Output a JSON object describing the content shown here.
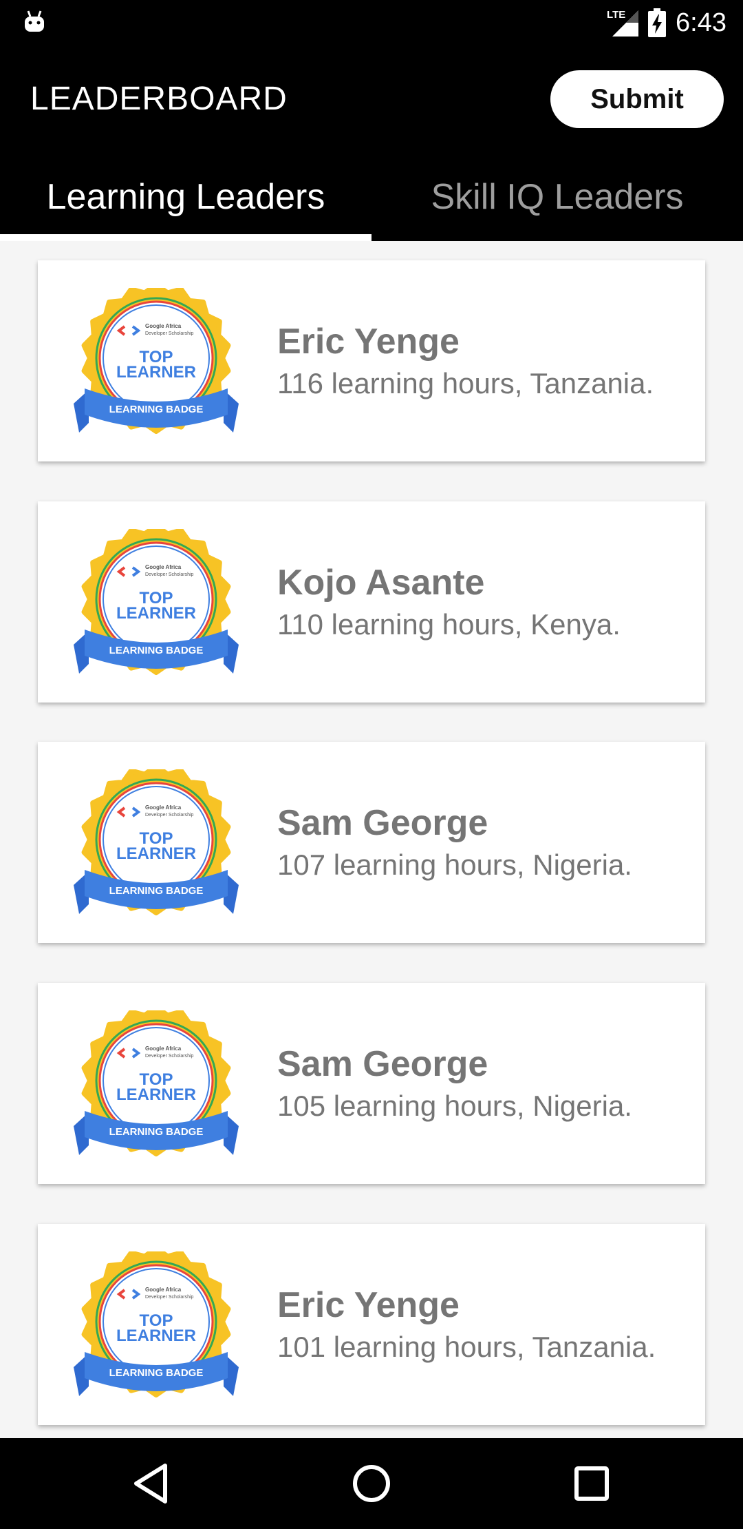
{
  "status_bar": {
    "network_label": "LTE",
    "time": "6:43"
  },
  "app_bar": {
    "title": "LEADERBOARD",
    "submit_label": "Submit"
  },
  "tabs": [
    {
      "label": "Learning Leaders",
      "selected": true
    },
    {
      "label": "Skill IQ Leaders",
      "selected": false
    }
  ],
  "badge": {
    "org_line1": "Google Africa",
    "org_line2": "Developer Scholarship",
    "line1": "TOP",
    "line2": "LEARNER",
    "ribbon": "LEARNING BADGE"
  },
  "leaders": [
    {
      "name": "Eric Yenge",
      "detail": "116 learning hours, Tanzania."
    },
    {
      "name": "Kojo Asante",
      "detail": "110 learning hours, Kenya."
    },
    {
      "name": "Sam George",
      "detail": "107 learning hours, Nigeria."
    },
    {
      "name": "Sam George",
      "detail": "105 learning hours, Nigeria."
    },
    {
      "name": "Eric Yenge",
      "detail": "101 learning hours, Tanzania."
    }
  ],
  "colors": {
    "bar_background": "#000000",
    "list_background": "#f5f5f5",
    "card_text": "#757575",
    "badge_gold": "#f7c325",
    "badge_blue": "#3f7fe0"
  },
  "icons": {
    "status_left": "android-debug-icon",
    "signal": "signal-strength-icon",
    "battery": "battery-charging-icon",
    "nav_back": "back-triangle-icon",
    "nav_home": "home-circle-icon",
    "nav_recents": "recents-square-icon"
  }
}
